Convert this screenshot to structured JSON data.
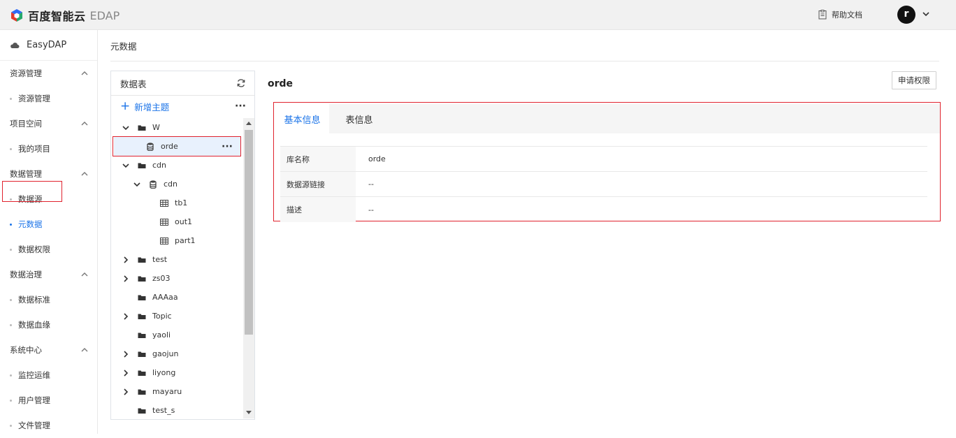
{
  "header": {
    "brand": "百度智能云",
    "product": "EDAP",
    "help_label": "帮助文档",
    "avatar_letter": "r",
    "colors": {
      "accent": "#1a73e8",
      "highlight": "#e0232e"
    }
  },
  "sidebar": {
    "app_name": "EasyDAP",
    "groups": [
      {
        "label": "资源管理",
        "items": [
          "资源管理"
        ]
      },
      {
        "label": "项目空间",
        "items": [
          "我的项目"
        ]
      },
      {
        "label": "数据管理",
        "items": [
          "数据源",
          "元数据",
          "数据权限"
        ]
      },
      {
        "label": "数据治理",
        "items": [
          "数据标准",
          "数据血缘"
        ]
      },
      {
        "label": "系统中心",
        "items": [
          "监控运维",
          "用户管理",
          "文件管理"
        ]
      }
    ],
    "active_item": "元数据"
  },
  "breadcrumb": "元数据",
  "tree": {
    "title": "数据表",
    "add_label": "新增主题",
    "nodes": [
      {
        "label": "W",
        "expanded": true,
        "type": "folder"
      },
      {
        "label": "orde",
        "type": "database",
        "selected": true
      },
      {
        "label": "cdn",
        "expanded": true,
        "type": "folder"
      },
      {
        "label": "cdn",
        "expanded": true,
        "type": "database"
      },
      {
        "label": "tb1",
        "type": "table"
      },
      {
        "label": "out1",
        "type": "table"
      },
      {
        "label": "part1",
        "type": "table"
      },
      {
        "label": "test",
        "expanded": false,
        "type": "folder"
      },
      {
        "label": "zs03",
        "expanded": false,
        "type": "folder"
      },
      {
        "label": "AAAaa",
        "type": "folder"
      },
      {
        "label": "Topic",
        "expanded": false,
        "type": "folder"
      },
      {
        "label": "yaoli",
        "type": "folder"
      },
      {
        "label": "gaojun",
        "expanded": false,
        "type": "folder"
      },
      {
        "label": "liyong",
        "expanded": false,
        "type": "folder"
      },
      {
        "label": "mayaru",
        "expanded": false,
        "type": "folder"
      },
      {
        "label": "test_s",
        "type": "folder"
      }
    ]
  },
  "detail": {
    "title": "orde",
    "apply_label": "申请权限",
    "tabs": [
      "基本信息",
      "表信息"
    ],
    "rows": [
      {
        "key": "库名称",
        "value": "orde"
      },
      {
        "key": "数据源链接",
        "value": "--"
      },
      {
        "key": "描述",
        "value": "--"
      }
    ]
  }
}
